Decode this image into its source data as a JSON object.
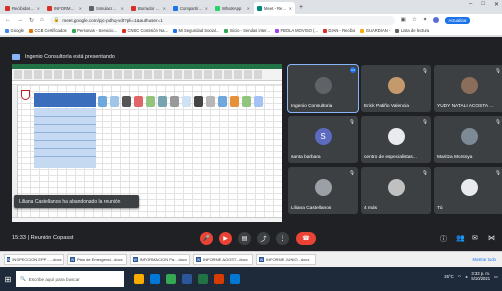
{
  "browser": {
    "tabs": [
      {
        "label": "Recibidos (1.704)",
        "color": "#d93025"
      },
      {
        "label": "INFORME AGOST...",
        "color": "#d93025"
      },
      {
        "label": "Simulacro Naci...",
        "color": "#5f6368"
      },
      {
        "label": "Borrador acta a...",
        "color": "#d93025"
      },
      {
        "label": "Compartir con...",
        "color": "#1a73e8"
      },
      {
        "label": "WhatsApp",
        "color": "#25d366"
      },
      {
        "label": "Meet - Reuni...",
        "color": "#00897b",
        "active": true
      }
    ],
    "url": "meet.google.com/pjc-pdhq-vdt?pli=1&authuser=1",
    "update_label": "Actualizar"
  },
  "bookmarks": [
    {
      "label": "Google",
      "color": "#4285f4"
    },
    {
      "label": "CCB Certificados",
      "color": "#e37400"
    },
    {
      "label": "Personas - Servicio...",
      "color": "#34a853"
    },
    {
      "label": "CNSC Comisión Na...",
      "color": "#d93025"
    },
    {
      "label": "Mi Seguridad Social...",
      "color": "#1a73e8"
    },
    {
      "label": "Inicio - Sendas inter...",
      "color": "#34a853"
    },
    {
      "label": "FBOLA MOVISO (...",
      "color": "#a142f4"
    },
    {
      "label": "DIAN - Recibo",
      "color": "#d93025"
    },
    {
      "label": "GUARDIAN -",
      "color": "#f9ab00"
    },
    {
      "label": "Lista de lectura",
      "color": "#5f6368"
    }
  ],
  "meeting": {
    "presenting_label": "Ingenio Consultoría está presentando",
    "toast": "Liliana Castellanos ha abandonado la reunión",
    "time": "15:33",
    "meeting_name": "Reunión Copasst"
  },
  "participants": [
    {
      "name": "Ingenio Consultoria",
      "initial": "",
      "color": "#5f6368",
      "speaking": true
    },
    {
      "name": "Erick Patiño Valencia",
      "initial": "",
      "color": "#c49a6c"
    },
    {
      "name": "YUDY NATALI ACOSTA ...",
      "initial": "",
      "color": "#8a6d5a"
    },
    {
      "name": "santa barbara",
      "initial": "S",
      "color": "#5c6bc0"
    },
    {
      "name": "centro de especialistas...",
      "initial": "",
      "color": "#e8eaed"
    },
    {
      "name": "Maritza Montoya",
      "initial": "",
      "color": "#7d8a96"
    },
    {
      "name": "Liliana Castellanos",
      "initial": "",
      "color": "#9aa0a6"
    },
    {
      "name": "4 más",
      "initial": "",
      "color": "#c0c0c0"
    },
    {
      "name": "Tú",
      "initial": "",
      "color": "#e8eaed"
    }
  ],
  "taskbar_items": [
    {
      "label": "INSPECCION EPP - ...docx"
    },
    {
      "label": "Plan de Emergenci...docx"
    },
    {
      "label": "INFORMACION Pa....docx"
    },
    {
      "label": "INFORME AGOST...docx"
    },
    {
      "label": "INFORME JUNIO...docx"
    }
  ],
  "show_all_label": "Mostrar todo",
  "taskbar": {
    "search_placeholder": "Escribe aquí para buscar",
    "temp": "25°C",
    "time": "3:33 p. m.",
    "date": "5/10/2021"
  }
}
